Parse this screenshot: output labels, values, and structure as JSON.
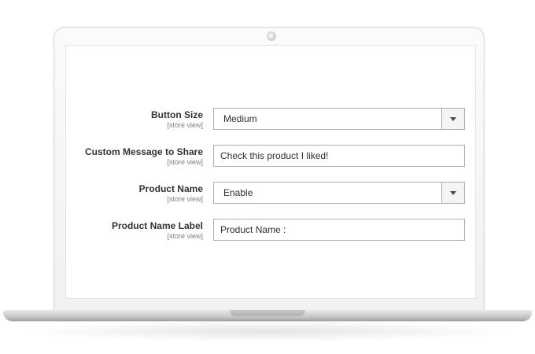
{
  "form": {
    "button_size": {
      "label": "Button Size",
      "scope": "[store view]",
      "value": "Medium"
    },
    "custom_message": {
      "label": "Custom Message to Share",
      "scope": "[store view]",
      "value": "Check this product I liked!"
    },
    "product_name": {
      "label": "Product Name",
      "scope": "[store view]",
      "value": "Enable"
    },
    "product_name_label": {
      "label": "Product Name Label",
      "scope": "[store view]",
      "value": "Product Name :"
    }
  },
  "icons": {
    "dropdown": "chevron-down-icon",
    "camera": "camera-icon"
  },
  "colors": {
    "label_text": "#333333",
    "scope_text": "#808080",
    "field_border": "#adadad",
    "arrow_bg": "#f4f4f4"
  }
}
